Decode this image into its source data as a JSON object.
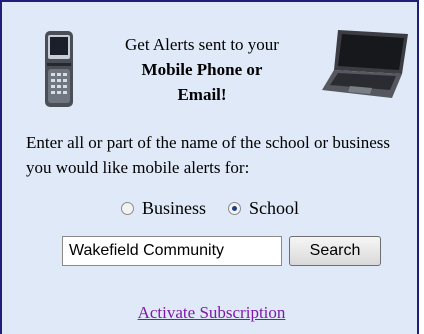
{
  "headline": {
    "line1": "Get Alerts sent to your",
    "line2": "Mobile Phone or",
    "line3": "Email!"
  },
  "prompt": {
    "text": "Enter all or part of the name of the school or business you would like mobile alerts for:"
  },
  "type_options": [
    {
      "label": "Business",
      "selected": false
    },
    {
      "label": "School",
      "selected": true
    }
  ],
  "search": {
    "value": "Wakefield Community",
    "button_label": "Search"
  },
  "activate_link": "Activate Subscription",
  "icons": {
    "left_image": "mobile-phone-icon",
    "right_image": "laptop-icon"
  },
  "colors": {
    "panel_background": "#dfe9f8",
    "panel_border": "#1f1f7a",
    "link": "#7d1aa6"
  }
}
